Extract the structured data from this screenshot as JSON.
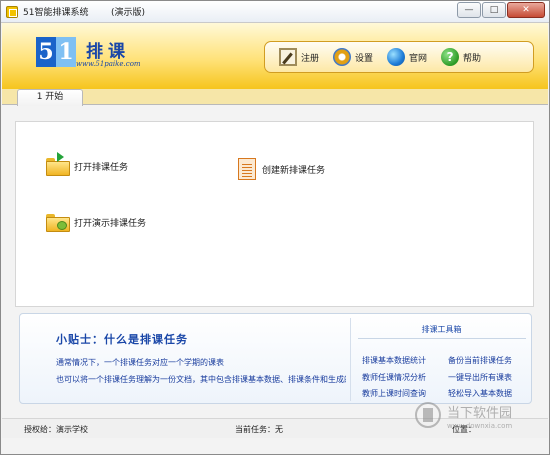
{
  "window": {
    "title": "51智能排课系统",
    "edition": "(演示版)",
    "buttons": {
      "minimize": "—",
      "maximize": "□",
      "close": "✕"
    }
  },
  "logo": {
    "digits": [
      "5",
      "1"
    ],
    "title": "排课",
    "url": "www.51paike.com"
  },
  "toolbar": {
    "register": "注册",
    "settings": "设置",
    "website": "官网",
    "help": "帮助"
  },
  "tabs": [
    {
      "label": "1 开始"
    }
  ],
  "actions": {
    "open_task": "打开排课任务",
    "new_task": "创建新排课任务",
    "open_demo": "打开演示排课任务"
  },
  "tips": {
    "title": "小贴士：什么是排课任务",
    "line1": "通常情况下，一个排课任务对应一个学期的课表",
    "line2": "也可以将一个排课任务理解为一份文档，其中包含排课基本数据、排课条件和生成的"
  },
  "tools": {
    "title": "排课工具箱",
    "links": [
      "排课基本数据统计",
      "备份当前排课任务",
      "教师任课情况分析",
      "一键导出所有课表",
      "教师上课时间查询",
      "轻松导入基本数据"
    ]
  },
  "status": {
    "licensed_to": "授权给：演示学校",
    "current_task": "当前任务：无",
    "position": "位置："
  },
  "watermark": {
    "text": "当下软件园",
    "url": "www.downxia.com"
  },
  "icons": {
    "register": "pen-sign-icon",
    "settings": "gear-icon",
    "website": "globe-icon",
    "help": "question-icon",
    "open_task": "folder-open-icon",
    "new_task": "document-icon",
    "open_demo": "folder-demo-icon"
  }
}
